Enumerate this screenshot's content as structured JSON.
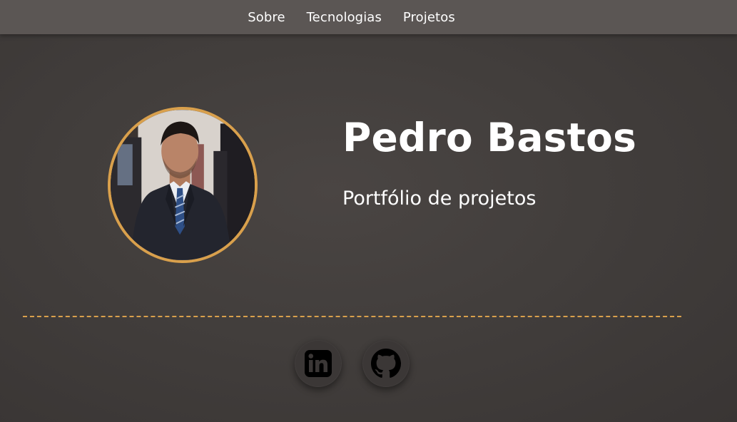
{
  "nav": {
    "items": [
      {
        "label": "Sobre"
      },
      {
        "label": "Tecnologias"
      },
      {
        "label": "Projetos"
      }
    ]
  },
  "hero": {
    "name": "Pedro Bastos",
    "subtitle": "Portfólio de projetos"
  },
  "social": {
    "links": [
      {
        "icon": "linkedin-icon"
      },
      {
        "icon": "github-icon"
      }
    ]
  },
  "colors": {
    "accent": "#d9a04c",
    "navbar": "#5b5654",
    "background": "#423e3c"
  }
}
